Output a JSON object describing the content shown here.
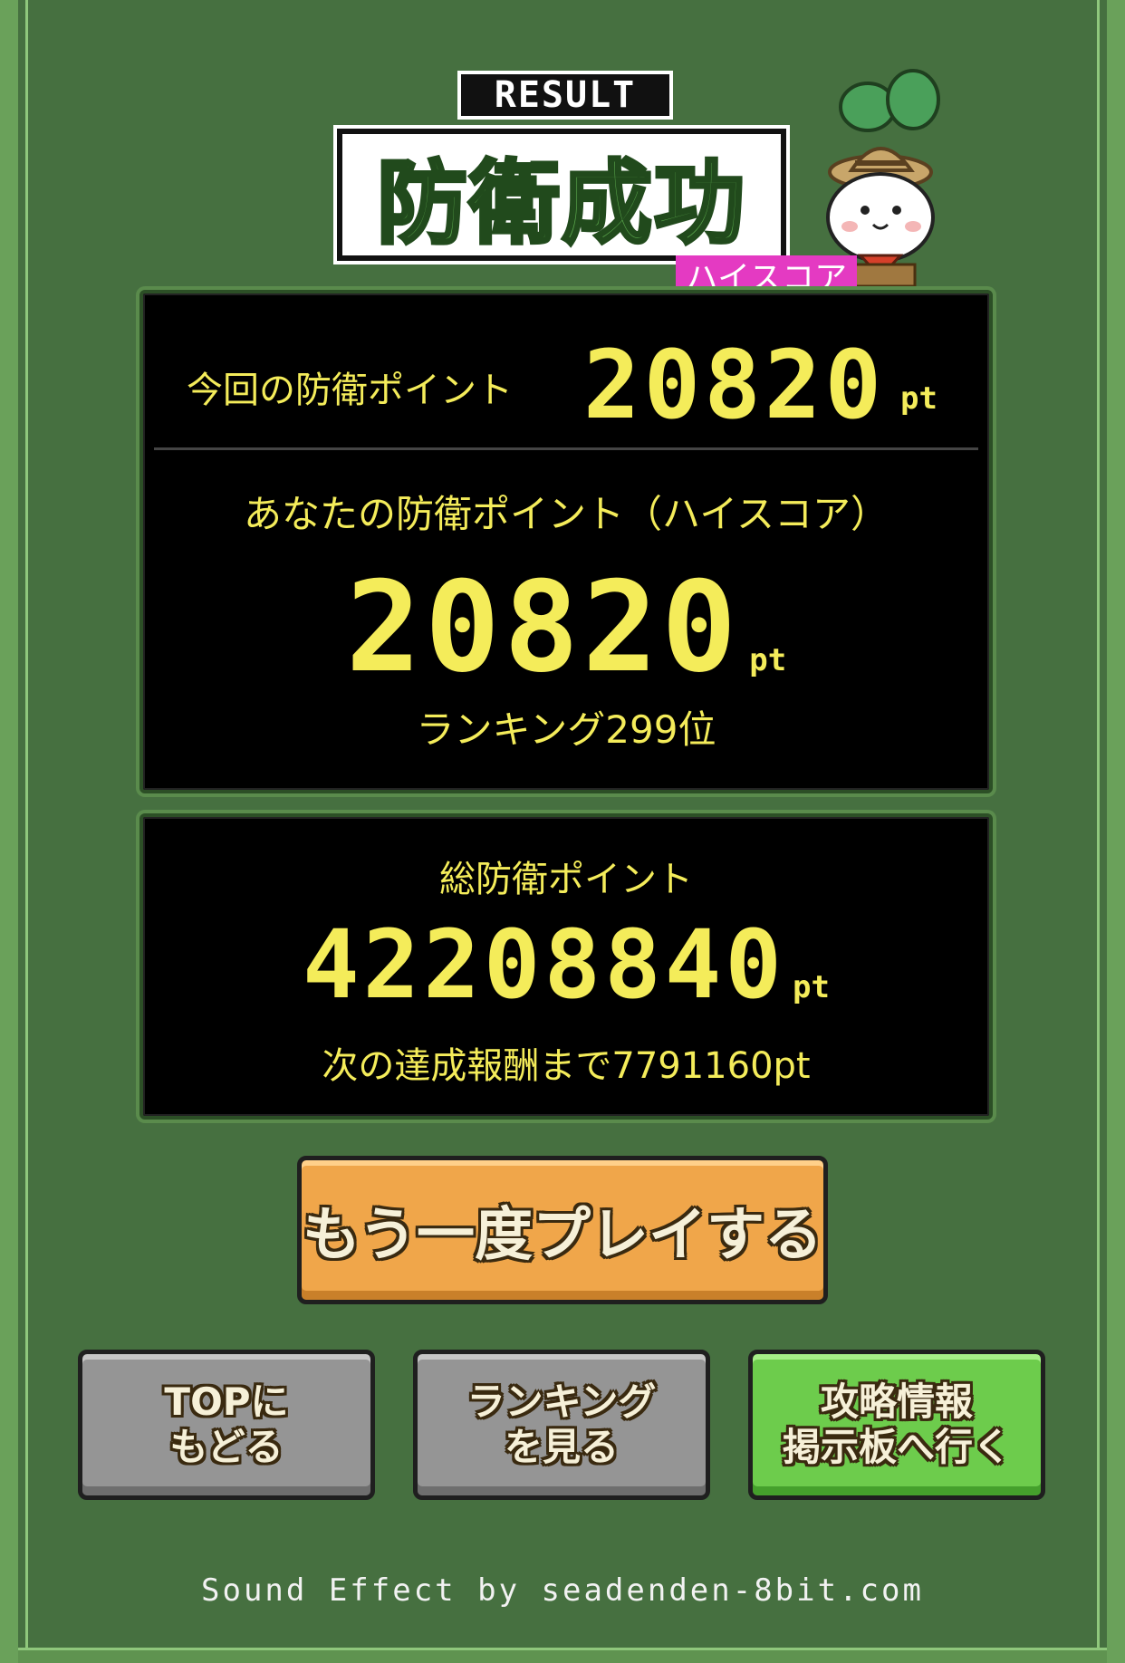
{
  "header": {
    "result_label": "RESULT",
    "title": "防衛成功",
    "hiscore_badge": "ハイスコア"
  },
  "current": {
    "label": "今回の防衛ポイント",
    "value": "20820",
    "unit": "pt"
  },
  "highscore": {
    "label": "あなたの防衛ポイント（ハイスコア）",
    "value": "20820",
    "unit": "pt",
    "ranking": "ランキング299位"
  },
  "total": {
    "label": "総防衛ポイント",
    "value": "42208840",
    "unit": "pt",
    "next_reward": "次の達成報酬まで7791160pt"
  },
  "buttons": {
    "replay": "もう一度プレイする",
    "top": "TOPに\nもどる",
    "ranking": "ランキング\nを見る",
    "board": "攻略情報\n掲示板へ行く"
  },
  "footer": "Sound Effect by seadenden-8bit.com",
  "colors": {
    "background": "#467040",
    "panel": "#000000",
    "text_yellow": "#f4ec5a",
    "badge_pink": "#e43ac2",
    "replay_orange": "#f0a64a",
    "gray_button": "#959595",
    "green_button": "#6dcc4c"
  }
}
